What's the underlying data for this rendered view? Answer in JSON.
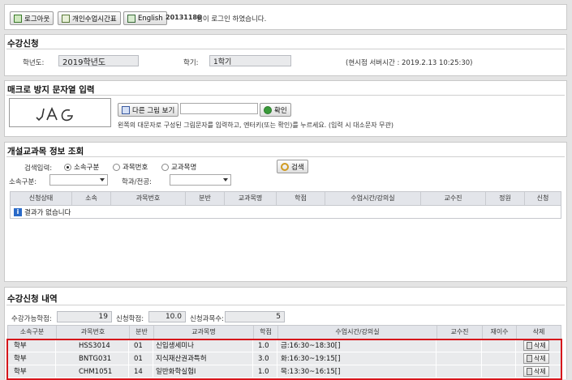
{
  "topbar": {
    "logout_label": "로그아웃",
    "timetable_label": "개인수업시간표",
    "english_label": "English",
    "user_id": "20131188",
    "login_message": " 님이 로그인 하였습니다."
  },
  "enroll": {
    "title": "수강신청",
    "year_label": "학년도:",
    "year_value": "2019학년도",
    "semester_label": "학기:",
    "semester_value": "1학기",
    "server_time": "(현시점 서버시간 : 2019.2.13 10:25:30)"
  },
  "macro": {
    "title": "매크로 방지 문자열 입력",
    "captcha_text": "JAG",
    "other_image_label": "다른 그림 보기",
    "confirm_label": "확인",
    "input_value": "",
    "hint": "왼쪽의 대문자로 구성된 그림문자를 입력하고, 엔터키(또는 확인)를 누르세요. (입력 시 대소문자 무관)"
  },
  "search": {
    "title": "개설교과목 정보 조회",
    "input_label": "검색입력:",
    "radio_options": [
      "소속구분",
      "과목번호",
      "교과목명"
    ],
    "selected_radio": 0,
    "search_label": "검색",
    "dept_type_label": "소속구분:",
    "dept_label": "학과/전공:",
    "columns": [
      "신청상태",
      "소속",
      "과목번호",
      "분반",
      "교과목명",
      "학점",
      "수업시간/강의실",
      "교수진",
      "정원",
      "신청"
    ],
    "empty_message": "결과가 없습니다"
  },
  "history": {
    "title": "수강신청 내역",
    "available_label": "수강가능학점:",
    "available_value": "19",
    "applied_label": "신청학점:",
    "applied_value": "10.0",
    "count_label": "신청과목수:",
    "count_value": "5",
    "columns": [
      "소속구분",
      "과목번호",
      "분반",
      "교과목명",
      "학점",
      "수업시간/강의실",
      "교수진",
      "재이수",
      "삭제"
    ],
    "delete_label": "삭제",
    "rows": [
      {
        "type": "학부",
        "code": "HSS3014",
        "section": "01",
        "name": "신입생세미나",
        "credit": "1.0",
        "time": "금:16:30~18:30[]",
        "professor": "",
        "retake": ""
      },
      {
        "type": "학부",
        "code": "BNTG031",
        "section": "01",
        "name": "지식재산권과특허",
        "credit": "3.0",
        "time": "화:16:30~19:15[]",
        "professor": "",
        "retake": ""
      },
      {
        "type": "학부",
        "code": "CHM1051",
        "section": "14",
        "name": "일반화학실험I",
        "credit": "1.0",
        "time": "목:13:30~16:15[]",
        "professor": "",
        "retake": ""
      }
    ]
  }
}
